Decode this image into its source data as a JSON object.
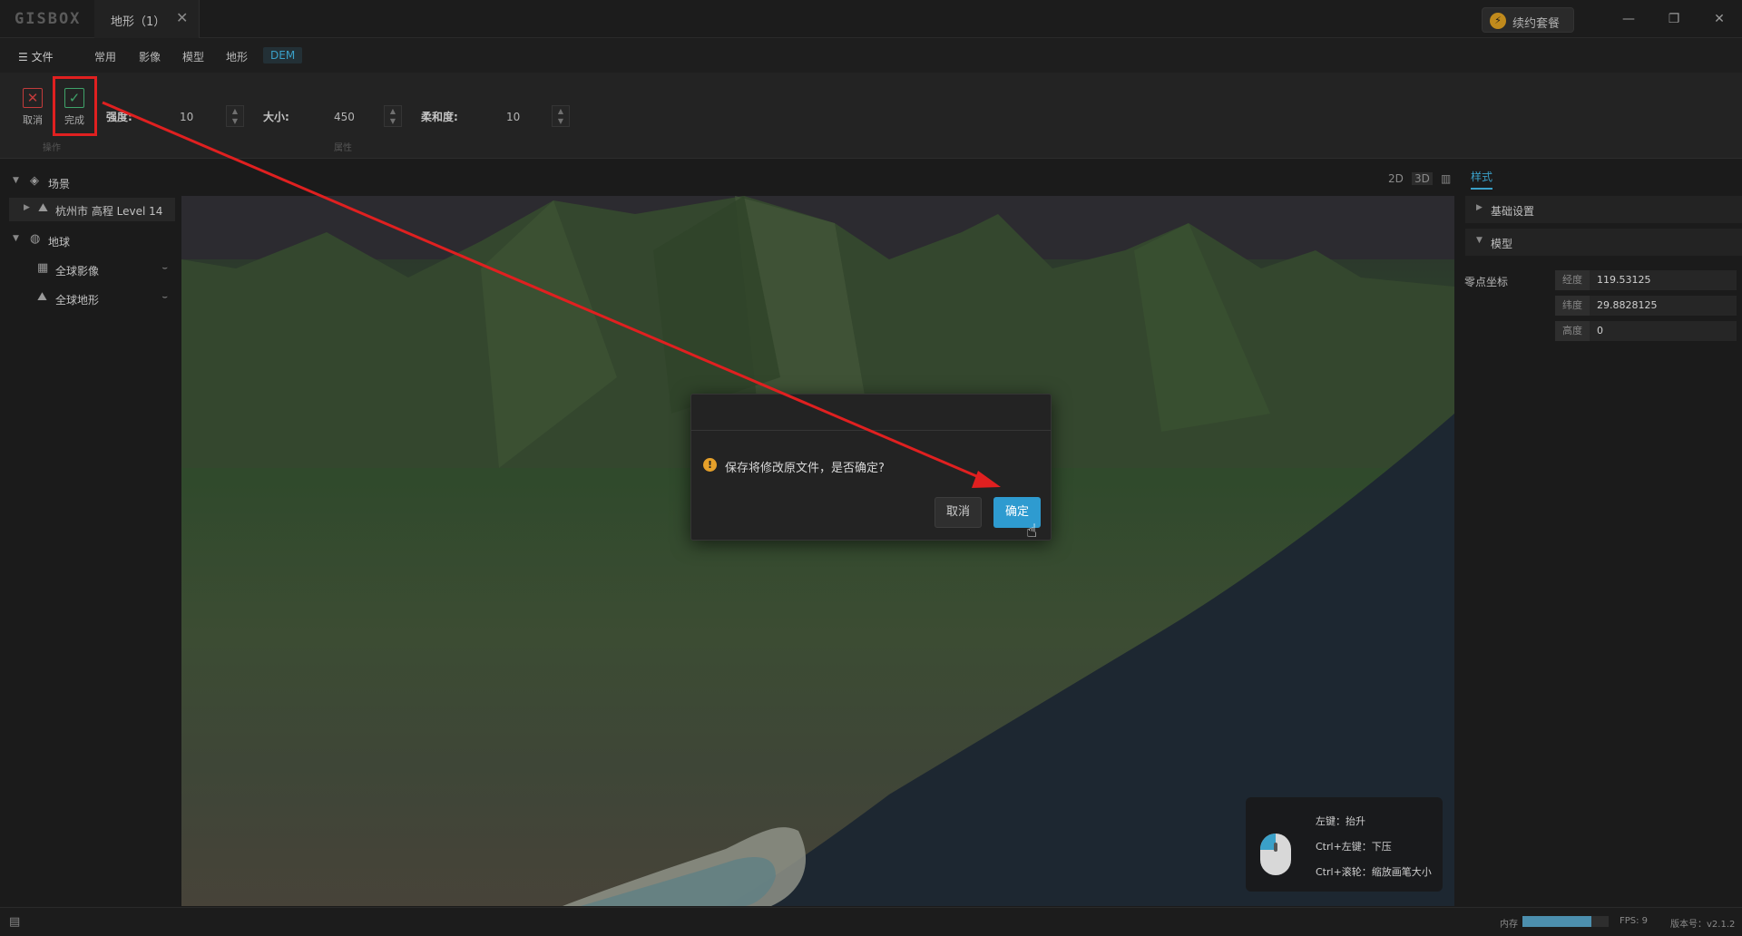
{
  "app": {
    "logo": "GISBOX"
  },
  "tab": {
    "title": "地形（1）",
    "close": "✕"
  },
  "titlebar": {
    "renew_label": "续约套餐",
    "minimize": "—",
    "restore": "❐",
    "close": "✕"
  },
  "menu": {
    "file_label": "☰ 文件",
    "items": [
      {
        "label": "常用",
        "active": false
      },
      {
        "label": "影像",
        "active": false
      },
      {
        "label": "模型",
        "active": false
      },
      {
        "label": "地形",
        "active": false
      },
      {
        "label": "DEM",
        "active": true
      }
    ]
  },
  "ribbon": {
    "cancel_label": "取消",
    "done_label": "完成",
    "group_operation": "操作",
    "group_property": "属性",
    "strength_label": "强度:",
    "strength_value": "10",
    "size_label": "大小:",
    "size_value": "450",
    "softness_label": "柔和度:",
    "softness_value": "10"
  },
  "left_panel": {
    "scene_label": "场景",
    "scene_item": "杭州市 高程 Level 14",
    "globe_label": "地球",
    "globe_imagery": "全球影像",
    "globe_terrain": "全球地形"
  },
  "view_modes": [
    "2D",
    "3D",
    "▥"
  ],
  "dialog": {
    "message": "保存将修改原文件，是否确定?",
    "cancel": "取消",
    "ok": "确定"
  },
  "hint": {
    "left_click": "左键：抬升",
    "ctrl_left": "Ctrl+左键：下压",
    "ctrl_wheel": "Ctrl+滚轮：缩放画笔大小"
  },
  "right_panel": {
    "tab_label": "样式",
    "basic_settings": "基础设置",
    "model_section": "模型",
    "origin_label": "零点坐标",
    "coords": [
      {
        "key": "经度",
        "value": "119.53125"
      },
      {
        "key": "纬度",
        "value": "29.8828125"
      },
      {
        "key": "高度",
        "value": "0"
      }
    ]
  },
  "statusbar": {
    "memory_label": "内存",
    "memory_fraction": 0.8,
    "fps": "FPS: 9",
    "version": "版本号：v2.1.2"
  },
  "colors": {
    "accent": "#2e9bd0",
    "annotation": "#e02020",
    "warning": "#e5a02a"
  }
}
